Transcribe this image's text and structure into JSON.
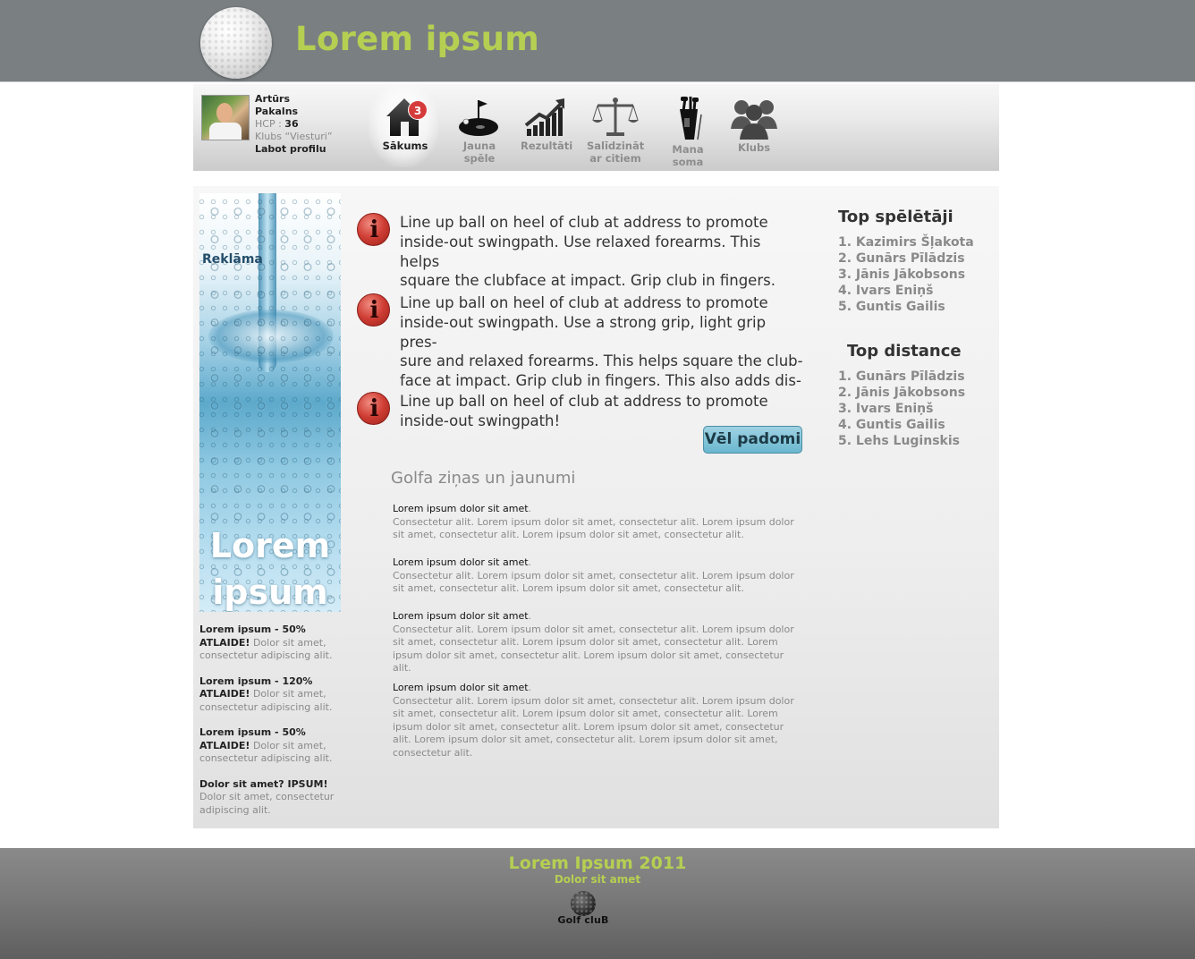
{
  "header": {
    "site_title": "Lorem ipsum"
  },
  "profile": {
    "first_name": "Artūrs",
    "last_name": "Pakalns",
    "hcp_label": "HCP : ",
    "hcp_value": "36",
    "club": "Klubs “Viesturi”",
    "edit_label": "Labot profilu"
  },
  "nav": {
    "items": [
      {
        "label": "Sākums",
        "icon": "home-icon",
        "badge": "3",
        "active": true
      },
      {
        "label": "Jauna spēle",
        "icon": "golf-flag-icon"
      },
      {
        "label": "Rezultāti",
        "icon": "chart-growth-icon"
      },
      {
        "label": "Salīdzināt ar citiem",
        "line1": "Salīdzināt",
        "line2": "ar citiem",
        "icon": "scales-icon"
      },
      {
        "label": "Mana soma",
        "icon": "golf-bag-icon"
      },
      {
        "label": "Klubs",
        "icon": "people-group-icon"
      }
    ]
  },
  "ad": {
    "label": "Reklāma",
    "title_line1": "Lorem",
    "title_line2": "ipsum"
  },
  "promos": [
    {
      "bold": "Lorem ipsum - 50% ATLAIDE!",
      "text": " Dolor sit amet, consectetur adipiscing alit."
    },
    {
      "bold": "Lorem ipsum - 120% ATLAIDE!",
      "text": " Dolor sit amet, consectetur adipiscing alit."
    },
    {
      "bold": "Lorem ipsum - 50% ATLAIDE!",
      "text": " Dolor sit amet, consectetur adipiscing alit."
    },
    {
      "bold": "Dolor sit amet? IPSUM!",
      "text": " Dolor sit amet, consectetur adipiscing alit."
    }
  ],
  "tips": [
    {
      "line1": "Line up ball on heel of club at  address to promote",
      "line2": "inside-out swingpath. Use relaxed forearms. This helps",
      "line3": "square the clubface at impact. Grip club in fingers.",
      "line4": ""
    },
    {
      "line1": "Line up ball on heel of club at  address to promote",
      "line2": "inside-out swingpath. Use a strong grip, light grip pres-",
      "line3": "sure and relaxed forearms. This helps square the club-",
      "line4": "face at impact. Grip club in fingers. This also adds dis-"
    },
    {
      "line1": "Line up ball on heel of club at  address to promote",
      "line2": "inside-out swingpath!",
      "line3": "",
      "line4": ""
    }
  ],
  "more_button": "Vēl padomi",
  "news": {
    "title": "Golfa ziņas un jaunumi",
    "items": [
      {
        "heading": "Lorem ipsum dolor sit amet",
        "dot": ".",
        "body": "Consectetur alit. Lorem ipsum dolor sit amet, consectetur alit. Lorem ipsum dolor sit amet, consectetur alit. Lorem ipsum dolor sit amet, consectetur alit."
      },
      {
        "heading": "Lorem ipsum dolor sit amet",
        "dot": ".",
        "body": "Consectetur alit. Lorem ipsum dolor sit amet, consectetur alit. Lorem ipsum dolor sit amet, consectetur alit. Lorem ipsum dolor sit amet, consectetur alit."
      },
      {
        "heading": "Lorem ipsum dolor sit amet",
        "dot": ".",
        "body": "Consectetur alit. Lorem ipsum dolor sit amet, consectetur alit. Lorem ipsum dolor sit amet, consectetur alit. Lorem ipsum dolor sit amet, consectetur alit. Lorem ipsum dolor sit amet, consectetur alit. Lorem ipsum dolor sit amet, consectetur alit."
      },
      {
        "heading": "Lorem ipsum dolor sit amet",
        "dot": ".",
        "body": "Consectetur alit. Lorem ipsum dolor sit amet, consectetur alit. Lorem ipsum dolor sit amet, consectetur alit. Lorem ipsum dolor sit amet, consectetur alit. Lorem ipsum dolor sit amet, consectetur alit. Lorem ipsum dolor sit amet, consectetur alit. Lorem ipsum dolor sit amet, consectetur alit. Lorem ipsum dolor sit amet, consectetur alit."
      }
    ]
  },
  "top_players": {
    "title": "Top spēlētāji",
    "items": [
      "1. Kazimirs Šļakota",
      "2. Gunārs Pīlādzis",
      "3. Jānis Jākobsons",
      "4. Ivars Eniņš",
      "5. Guntis Gailis"
    ]
  },
  "top_distance": {
    "title": "Top distance",
    "items": [
      "1. Gunārs Pīlādzis",
      "2. Jānis Jākobsons",
      "3. Ivars Eniņš",
      "4. Guntis Gailis",
      "5. Lehs Luginskis"
    ]
  },
  "footer": {
    "title": "Lorem Ipsum 2011",
    "subtitle": "Dolor sit amet",
    "logo_text": "Golf cluB"
  },
  "colors": {
    "header_bg": "#7a7f82",
    "accent_green": "#b5cf52",
    "button_blue": "#6ab7cf",
    "badge_red": "#d63b3b"
  }
}
